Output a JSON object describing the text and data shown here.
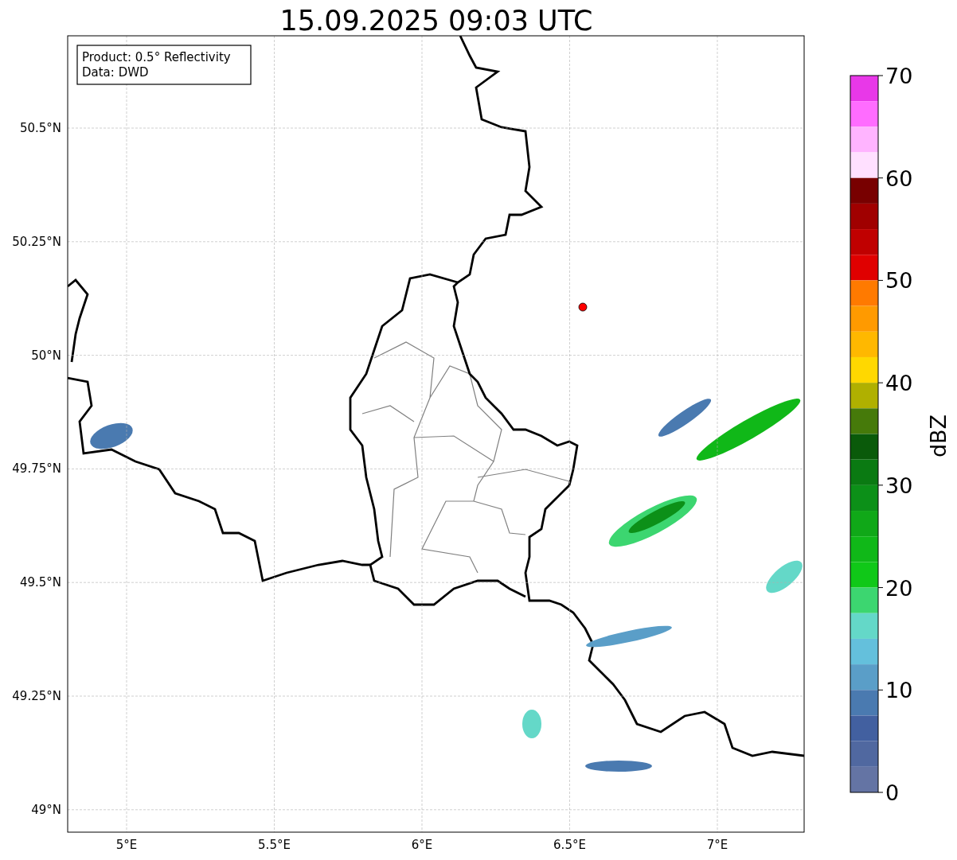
{
  "title": "15.09.2025 09:03 UTC",
  "info_box": [
    "Product: 0.5° Reflectivity",
    "Data: DWD"
  ],
  "y_ticks": [
    "50.5°N",
    "50.25°N",
    "50°N",
    "49.75°N",
    "49.5°N",
    "49.25°N",
    "49°N"
  ],
  "x_ticks": [
    "5°E",
    "5.5°E",
    "6°E",
    "6.5°E",
    "7°E"
  ],
  "colorbar": {
    "label": "dBZ",
    "ticks": [
      "70",
      "60",
      "50",
      "40",
      "30",
      "20",
      "10",
      "0"
    ],
    "segments": [
      {
        "color": "#e838e8"
      },
      {
        "color": "#ff6cff"
      },
      {
        "color": "#ffb4ff"
      },
      {
        "color": "#ffe0ff"
      },
      {
        "color": "#780000"
      },
      {
        "color": "#a00000"
      },
      {
        "color": "#c00000"
      },
      {
        "color": "#e00000"
      },
      {
        "color": "#ff7a00"
      },
      {
        "color": "#ff9a00"
      },
      {
        "color": "#ffb800"
      },
      {
        "color": "#ffd800"
      },
      {
        "color": "#b0b000"
      },
      {
        "color": "#467a0a"
      },
      {
        "color": "#0a5a0a"
      },
      {
        "color": "#0a7a12"
      },
      {
        "color": "#0c9018"
      },
      {
        "color": "#10a818"
      },
      {
        "color": "#10b818"
      },
      {
        "color": "#10c818"
      },
      {
        "color": "#3cd670"
      },
      {
        "color": "#64d8c8"
      },
      {
        "color": "#64c0dc"
      },
      {
        "color": "#5a9ec8"
      },
      {
        "color": "#4a7ab0"
      },
      {
        "color": "#4260a0"
      },
      {
        "color": "#5068a0"
      },
      {
        "color": "#6474a4"
      }
    ]
  }
}
